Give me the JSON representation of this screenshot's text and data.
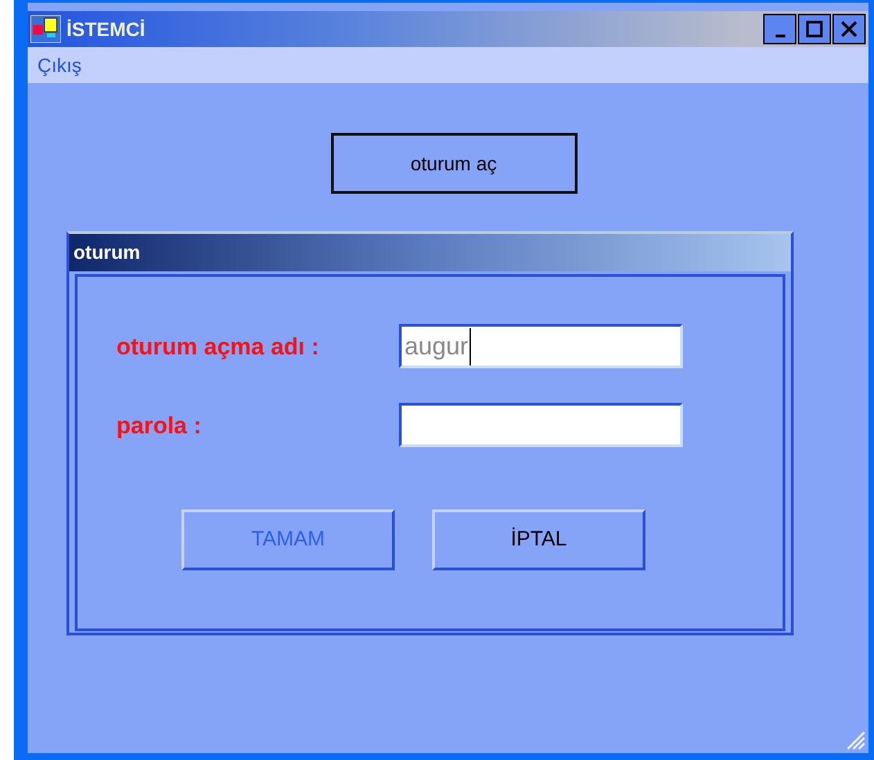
{
  "window": {
    "title": "İSTEMCİ"
  },
  "menu": [
    {
      "label": "Çıkış"
    }
  ],
  "open_button": {
    "label": "oturum aç"
  },
  "group": {
    "title": "oturum",
    "fields": [
      {
        "label": "oturum açma adı :",
        "value": "augur"
      },
      {
        "label": "parola :"
      }
    ],
    "buttons": [
      {
        "label": "TAMAM",
        "disabled": true
      },
      {
        "label": "İPTAL",
        "disabled": false
      }
    ]
  }
}
